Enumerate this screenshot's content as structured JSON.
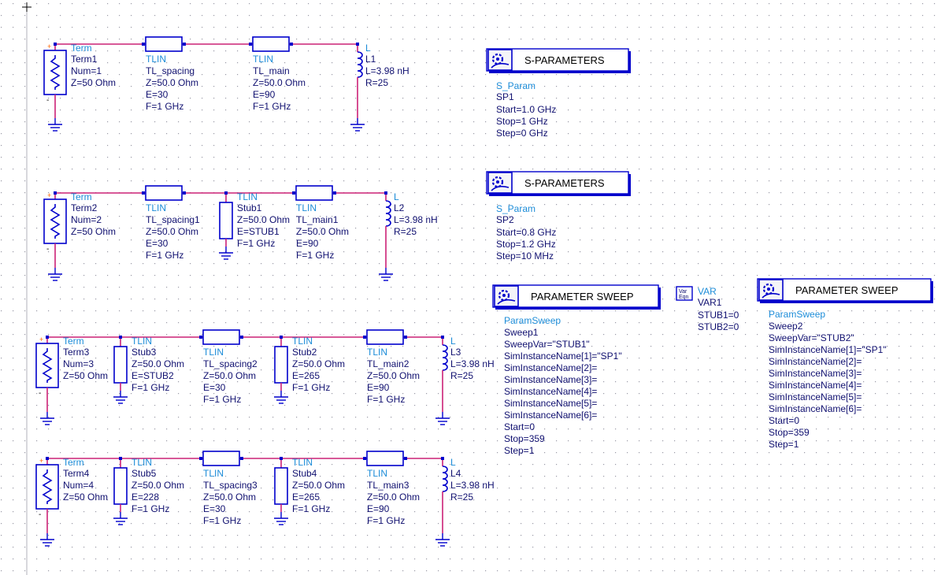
{
  "app": {
    "name": "ADS Schematic"
  },
  "colors": {
    "wire": "#cc2277",
    "component": "#0000cc",
    "label_type": "#1c8cd8",
    "label_param": "#101070",
    "grid": "#9a9aa6"
  },
  "circuits": [
    {
      "term": {
        "type": "Term",
        "name": "Term1",
        "num": "Num=1",
        "z": "Z=50 Ohm"
      },
      "stubs_left": [],
      "tl_spacing": {
        "type": "TLIN",
        "name": "TL_spacing",
        "z": "Z=50.0 Ohm",
        "e": "E=30",
        "f": "F=1 GHz"
      },
      "stubs_mid": [],
      "tl_main": {
        "type": "TLIN",
        "name": "TL_main",
        "z": "Z=50.0 Ohm",
        "e": "E=90",
        "f": "F=1 GHz"
      },
      "ind": {
        "type": "L",
        "name": "L1",
        "l": "L=3.98 nH",
        "r": "R=25"
      }
    },
    {
      "term": {
        "type": "Term",
        "name": "Term2",
        "num": "Num=2",
        "z": "Z=50 Ohm"
      },
      "stubs_left": [],
      "tl_spacing": {
        "type": "TLIN",
        "name": "TL_spacing1",
        "z": "Z=50.0 Ohm",
        "e": "E=30",
        "f": "F=1 GHz"
      },
      "stubs_mid": [
        {
          "type": "TLIN",
          "name": "Stub1",
          "z": "Z=50.0 Ohm",
          "e": "E=STUB1",
          "f": "F=1 GHz"
        }
      ],
      "tl_main": {
        "type": "TLIN",
        "name": "TL_main1",
        "z": "Z=50.0 Ohm",
        "e": "E=90",
        "f": "F=1 GHz"
      },
      "ind": {
        "type": "L",
        "name": "L2",
        "l": "L=3.98 nH",
        "r": "R=25"
      }
    },
    {
      "term": {
        "type": "Term",
        "name": "Term3",
        "num": "Num=3",
        "z": "Z=50 Ohm"
      },
      "stubs_left": [
        {
          "type": "TLIN",
          "name": "Stub3",
          "z": "Z=50.0 Ohm",
          "e": "E=STUB2",
          "f": "F=1 GHz"
        }
      ],
      "tl_spacing": {
        "type": "TLIN",
        "name": "TL_spacing2",
        "z": "Z=50.0 Ohm",
        "e": "E=30",
        "f": "F=1 GHz"
      },
      "stubs_mid": [
        {
          "type": "TLIN",
          "name": "Stub2",
          "z": "Z=50.0 Ohm",
          "e": "E=265",
          "f": "F=1 GHz"
        }
      ],
      "tl_main": {
        "type": "TLIN",
        "name": "TL_main2",
        "z": "Z=50.0 Ohm",
        "e": "E=90",
        "f": "F=1 GHz"
      },
      "ind": {
        "type": "L",
        "name": "L3",
        "l": "L=3.98 nH",
        "r": "R=25"
      }
    },
    {
      "term": {
        "type": "Term",
        "name": "Term4",
        "num": "Num=4",
        "z": "Z=50 Ohm"
      },
      "stubs_left": [
        {
          "type": "TLIN",
          "name": "Stub5",
          "z": "Z=50.0 Ohm",
          "e": "E=228",
          "f": "F=1 GHz"
        }
      ],
      "tl_spacing": {
        "type": "TLIN",
        "name": "TL_spacing3",
        "z": "Z=50.0 Ohm",
        "e": "E=30",
        "f": "F=1 GHz"
      },
      "stubs_mid": [
        {
          "type": "TLIN",
          "name": "Stub4",
          "z": "Z=50.0 Ohm",
          "e": "E=265",
          "f": "F=1 GHz"
        }
      ],
      "tl_main": {
        "type": "TLIN",
        "name": "TL_main3",
        "z": "Z=50.0 Ohm",
        "e": "E=90",
        "f": "F=1 GHz"
      },
      "ind": {
        "type": "L",
        "name": "L4",
        "l": "L=3.98 nH",
        "r": "R=25"
      }
    }
  ],
  "sparams": [
    {
      "title": "S-PARAMETERS",
      "type": "S_Param",
      "name": "SP1",
      "lines": [
        "Start=1.0 GHz",
        "Stop=1 GHz",
        "Step=0 GHz"
      ]
    },
    {
      "title": "S-PARAMETERS",
      "type": "S_Param",
      "name": "SP2",
      "lines": [
        "Start=0.8 GHz",
        "Stop=1.2 GHz",
        "Step=10 MHz"
      ]
    }
  ],
  "sweeps": [
    {
      "title": "PARAMETER SWEEP",
      "type": "ParamSweep",
      "name": "Sweep1",
      "lines": [
        "SweepVar=\"STUB1\"",
        "SimInstanceName[1]=\"SP1\"",
        "SimInstanceName[2]=",
        "SimInstanceName[3]=",
        "SimInstanceName[4]=",
        "SimInstanceName[5]=",
        "SimInstanceName[6]=",
        "Start=0",
        "Stop=359",
        "Step=1"
      ]
    },
    {
      "title": "PARAMETER SWEEP",
      "type": "ParamSweep",
      "name": "Sweep2",
      "lines": [
        "SweepVar=\"STUB2\"",
        "SimInstanceName[1]=\"SP1\"",
        "SimInstanceName[2]=",
        "SimInstanceName[3]=",
        "SimInstanceName[4]=",
        "SimInstanceName[5]=",
        "SimInstanceName[6]=",
        "Start=0",
        "Stop=359",
        "Step=1"
      ]
    }
  ],
  "var": {
    "type": "VAR",
    "name": "VAR1",
    "icon_top": "Var",
    "icon_bottom": "Eqn",
    "lines": [
      "STUB1=0",
      "STUB2=0"
    ]
  },
  "icons": {
    "sim_icon": "simulation-gear-icon",
    "var_icon": "var-eqn-icon",
    "cursor": "crosshair-cursor-icon"
  }
}
